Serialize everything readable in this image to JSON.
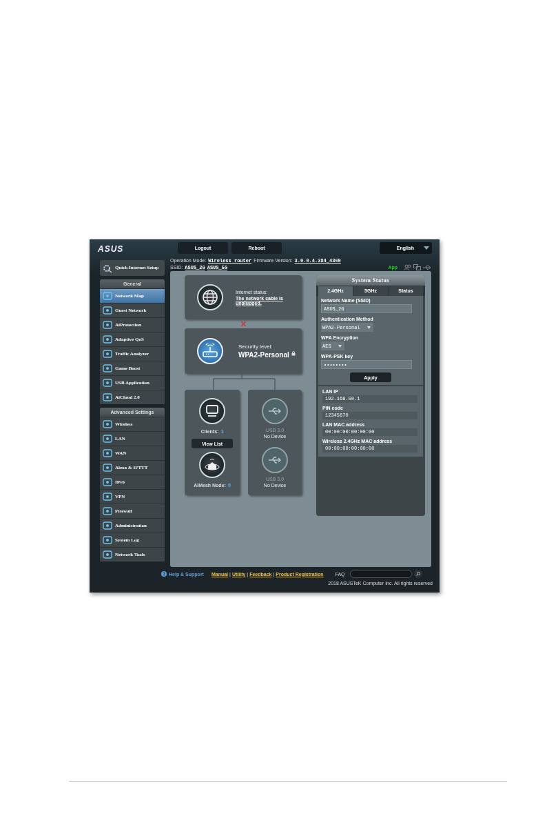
{
  "header": {
    "logo": "ASUS",
    "buttons": [
      "Logout",
      "Reboot"
    ],
    "language": "English"
  },
  "info": {
    "operation_mode_label": "Operation Mode:",
    "operation_mode": "Wireless router",
    "firmware_label": "Firmware Version:",
    "firmware": "3.0.0.4.384_4360",
    "ssid_label": "SSID:",
    "ssids": [
      "ASUS_2G",
      "ASUS_5G"
    ],
    "app": "App"
  },
  "quick_setup": "Quick Internet Setup",
  "menu_sections": [
    {
      "title": "General",
      "items": [
        {
          "label": "Network Map",
          "selected": true
        },
        {
          "label": "Guest Network",
          "selected": false
        },
        {
          "label": "AiProtection",
          "selected": false
        },
        {
          "label": "Adaptive QoS",
          "selected": false
        },
        {
          "label": "Traffic Analyzer",
          "selected": false
        },
        {
          "label": "Game Boost",
          "selected": false
        },
        {
          "label": "USB Application",
          "selected": false
        },
        {
          "label": "AiCloud 2.0",
          "selected": false
        }
      ]
    },
    {
      "title": "Advanced Settings",
      "items": [
        {
          "label": "Wireless",
          "selected": false
        },
        {
          "label": "LAN",
          "selected": false
        },
        {
          "label": "WAN",
          "selected": false
        },
        {
          "label": "Alexa & IFTTT",
          "selected": false
        },
        {
          "label": "IPv6",
          "selected": false
        },
        {
          "label": "VPN",
          "selected": false
        },
        {
          "label": "Firewall",
          "selected": false
        },
        {
          "label": "Administration",
          "selected": false
        },
        {
          "label": "System Log",
          "selected": false
        },
        {
          "label": "Network Tools",
          "selected": false
        }
      ]
    }
  ],
  "map": {
    "internet": {
      "label": "Internet status:",
      "status": "The network cable is unplugged.",
      "connected": false
    },
    "router": {
      "label": "Security level:",
      "value": "WPA2-Personal"
    },
    "clients": {
      "label": "Clients:",
      "count": "1",
      "button": "View List"
    },
    "aimesh": {
      "label": "AiMesh Node:",
      "count": "0"
    },
    "usb": [
      {
        "label": "USB 3.0",
        "status": "No Device"
      },
      {
        "label": "USB 3.0",
        "status": "No Device"
      }
    ]
  },
  "system_status": {
    "title": "System Status",
    "tabs": [
      {
        "label": "2.4GHz",
        "selected": true
      },
      {
        "label": "5GHz",
        "selected": false
      },
      {
        "label": "Status",
        "selected": false
      }
    ],
    "fields": [
      {
        "kind": "text",
        "label": "Network Name (SSID)",
        "value": "ASUS_2G"
      },
      {
        "kind": "select",
        "label": "Authentication Method",
        "value": "WPA2-Personal"
      },
      {
        "kind": "select",
        "label": "WPA Encryption",
        "value": "AES"
      },
      {
        "kind": "text",
        "label": "WPA-PSK key",
        "value": "••••••••"
      }
    ],
    "apply": "Apply",
    "info": [
      {
        "label": "LAN IP",
        "value": "192.168.50.1"
      },
      {
        "label": "PIN code",
        "value": "12345670"
      },
      {
        "label": "LAN MAC address",
        "value": "00:00:00:00:00:00"
      },
      {
        "label": "Wireless 2.4GHz MAC address",
        "value": "00:00:00:00:00:00"
      }
    ]
  },
  "footer": {
    "help": "Help & Support",
    "separator": "|",
    "links": [
      "Manual",
      "Utility",
      "Feedback",
      "Product Registration"
    ],
    "faq": "FAQ",
    "copyright": "2018 ASUSTeK Computer Inc. All rights reserved"
  }
}
